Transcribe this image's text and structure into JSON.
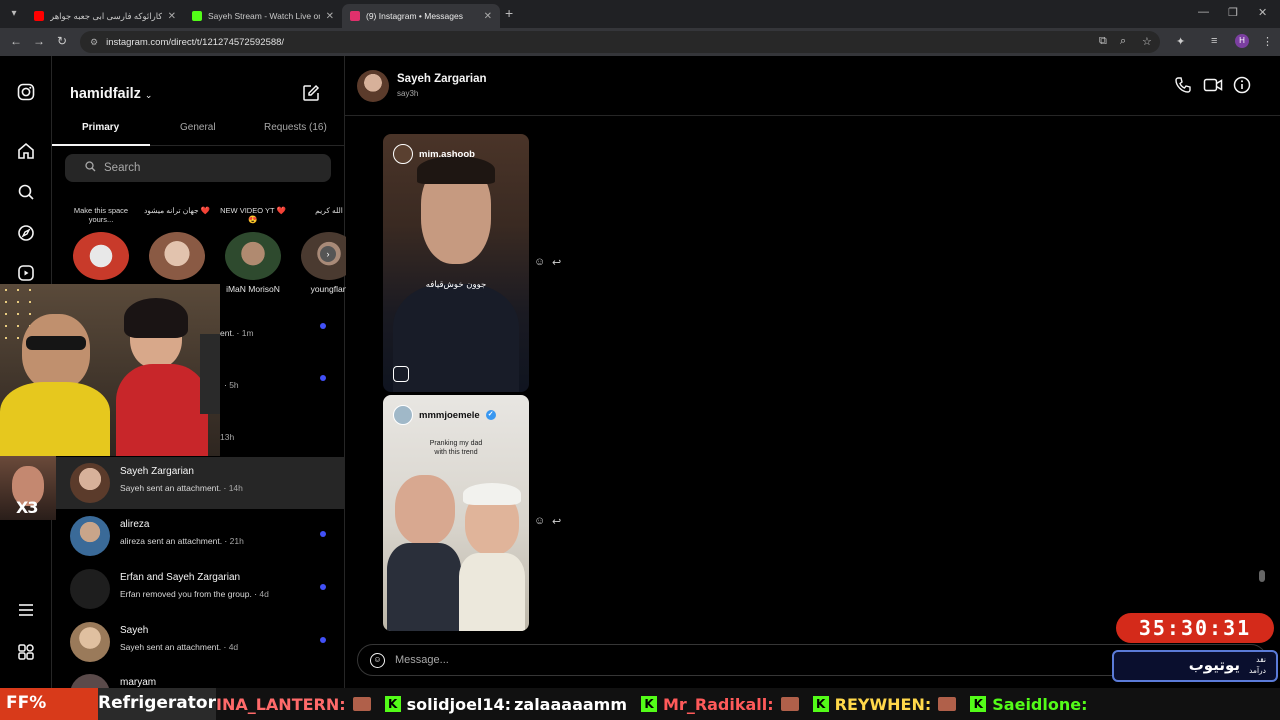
{
  "browser": {
    "tabs": [
      {
        "title": "کارائوکه فارسی ابی جعبه جواهر -",
        "favicon_color": "#ff0000"
      },
      {
        "title": "Sayeh Stream - Watch Live on Kick",
        "favicon_color": "#53fc18"
      },
      {
        "title": "(9) Instagram • Messages",
        "favicon_color": "#e1306c",
        "active": true
      }
    ],
    "url": "instagram.com/direct/t/121274572592588/",
    "profile_initial": "H"
  },
  "inbox": {
    "username": "hamidfailz",
    "tabs": [
      "Primary",
      "General",
      "Requests (16)"
    ],
    "search_placeholder": "Search",
    "notes": [
      {
        "bubble": "Make this space yours...",
        "name": "",
        "color": "#c83a2a"
      },
      {
        "bubble": "جهان ترانه میشود ❤️",
        "name": "",
        "color": "#b98a74"
      },
      {
        "bubble": "NEW VIDEO YT ❤️😍",
        "name": "iMaN MorisoN",
        "color": "#3a5a3a"
      },
      {
        "bubble": "الله كريم",
        "name": "youngflan",
        "color": "#6a5a4a"
      }
    ],
    "conversations": [
      {
        "name": "",
        "sub": "ent.",
        "time": "1m",
        "unread": true,
        "color": "#333"
      },
      {
        "name": "",
        "sub": "",
        "time": "5h",
        "unread": true,
        "color": "#333"
      },
      {
        "name": "",
        "sub": "",
        "time": "13h",
        "unread": false,
        "color": "#333"
      },
      {
        "name": "Sayeh Zargarian",
        "sub": "Sayeh sent an attachment.",
        "time": "14h",
        "unread": false,
        "color": "#8a6a5a",
        "selected": true
      },
      {
        "name": "alireza",
        "sub": "alireza sent an attachment.",
        "time": "21h",
        "unread": true,
        "color": "#4a7aa8"
      },
      {
        "name": "Erfan and Sayeh Zargarian",
        "sub": "Erfan removed you from the group.",
        "time": "4d",
        "unread": true,
        "color": "#222"
      },
      {
        "name": "Sayeh",
        "sub": "Sayeh sent an attachment.",
        "time": "4d",
        "unread": true,
        "color": "#a8886a"
      },
      {
        "name": "maryam",
        "sub": "",
        "time": "",
        "unread": false,
        "color": "#6a5a5a"
      }
    ]
  },
  "chat": {
    "name": "Sayeh Zargarian",
    "handle": "say3h",
    "reels": [
      {
        "user": "mim.ashoob",
        "caption": "جوون خوش‌قیافه",
        "verified": false
      },
      {
        "user": "mmmjoemele",
        "caption": "Pranking my dad with this trend",
        "verified": true
      }
    ],
    "composer_placeholder": "Message..."
  },
  "overlay": {
    "timer": "35:30:31",
    "yt_label": "یوتیوب",
    "yt_sub1": "نقد",
    "yt_sub2": "درآمد",
    "multiplier": "X3",
    "ticker_left": "FF%",
    "ticker_item": "Refrigerator",
    "ticker_msgs": [
      {
        "user": "INA_LANTERN:",
        "text": ""
      },
      {
        "user": "solidjoel14:",
        "text": "zalaaaaamm"
      },
      {
        "user": "Mr_Radikall:",
        "text": ""
      },
      {
        "user": "REYWHEN:",
        "text": ""
      },
      {
        "user": "Saeidlone:",
        "text": ""
      }
    ]
  }
}
